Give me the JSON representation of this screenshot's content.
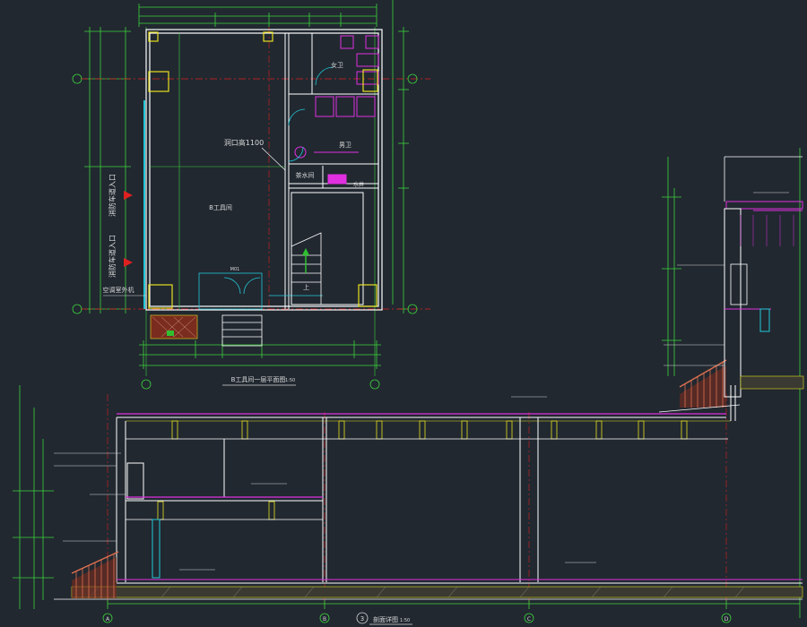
{
  "colors": {
    "background": "#212830",
    "wall": "#ffffff",
    "dimension": "#3cd23c",
    "axis": "#e02020",
    "cyan": "#22c8d8",
    "magenta": "#e030e0",
    "yellow": "#e8e020",
    "green": "#30c030",
    "label": "#d8d8d8"
  },
  "plan": {
    "title": "B工具间一层平面图",
    "scale": "1:50",
    "rooms": {
      "main": "B工具间",
      "women_wc": "女卫",
      "men_wc": "男卫",
      "hot_water": "茶水间",
      "water_well": "水井"
    },
    "notes": {
      "opening": "洞口高1100",
      "up": "上",
      "door_tag": "M01"
    },
    "side_labels": {
      "entrance_1": "消防车道入口",
      "entrance_2": "消防车道入口",
      "ac_outdoor": "空调室外机"
    }
  },
  "section": {
    "number": "3",
    "title": "剖面详图",
    "scale": "1:50",
    "axes": [
      "A",
      "B",
      "C",
      "D"
    ]
  }
}
